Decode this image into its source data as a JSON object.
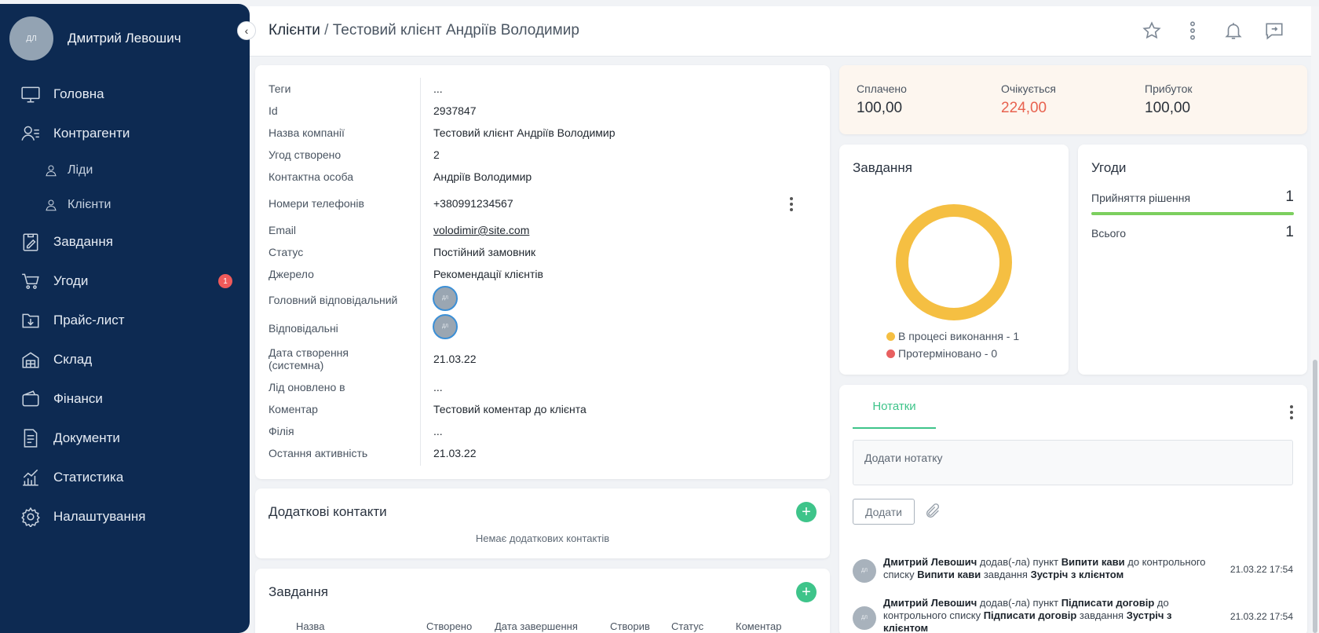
{
  "user": {
    "initials": "ДЛ",
    "name": "Дмитрий Левошич"
  },
  "nav": [
    {
      "label": "Головна",
      "icon": "monitor-icon"
    },
    {
      "label": "Контрагенти",
      "icon": "contacts-icon"
    },
    {
      "label": "Ліди",
      "icon": "user-icon",
      "sub": true
    },
    {
      "label": "Клієнти",
      "icon": "user-icon",
      "sub": true
    },
    {
      "label": "Завдання",
      "icon": "clipboard-icon"
    },
    {
      "label": "Угоди",
      "icon": "cart-icon",
      "badge": "1"
    },
    {
      "label": "Прайс-лист",
      "icon": "folder-icon"
    },
    {
      "label": "Склад",
      "icon": "warehouse-icon"
    },
    {
      "label": "Фінанси",
      "icon": "wallet-icon"
    },
    {
      "label": "Документи",
      "icon": "document-icon"
    },
    {
      "label": "Статистика",
      "icon": "chart-icon"
    },
    {
      "label": "Налаштування",
      "icon": "gear-icon"
    }
  ],
  "header": {
    "section": "Клієнти",
    "separator": "/",
    "current": "Тестовий клієнт Андріїв Володимир"
  },
  "info": {
    "tags_label": "Теги",
    "tags": "...",
    "id_label": "Id",
    "id": "2937847",
    "company_label": "Назва компанії",
    "company": "Тестовий клієнт Андріїв Володимир",
    "deals_label": "Угод створено",
    "deals": "2",
    "contact_label": "Контактна особа",
    "contact": "Андріїв Володимир",
    "phones_label": "Номери телефонів",
    "phone": "+380991234567",
    "email_label": "Email",
    "email": "volodimir@site.com",
    "status_label": "Статус",
    "status": "Постійний замовник",
    "source_label": "Джерело",
    "source": "Рекомендації клієнтів",
    "main_resp_label": "Головний відповідальний",
    "resp_label": "Відповідальні",
    "created_label_1": "Дата створення",
    "created_label_2": "(системна)",
    "created": "21.03.22",
    "lead_updated_label": "Лід оновлено в",
    "lead_updated": "...",
    "comment_label": "Коментар",
    "comment": "Тестовий коментар до клієнта",
    "branch_label": "Філія",
    "branch": "...",
    "activity_label": "Остання активність",
    "activity": "21.03.22",
    "avatar_initials": "ДЛ"
  },
  "contacts": {
    "title": "Додаткові контакти",
    "empty": "Немає додаткових контактів"
  },
  "tasks_table": {
    "title": "Завдання",
    "columns": [
      "Назва",
      "Створено",
      "Дата завершення",
      "Створив",
      "Статус",
      "Коментар"
    ]
  },
  "payments": {
    "paid_label": "Сплачено",
    "paid": "100,00",
    "expected_label": "Очікується",
    "expected": "224,00",
    "profit_label": "Прибуток",
    "profit": "100,00"
  },
  "tasks_chart": {
    "title": "Завдання",
    "legend": [
      {
        "label": "В процесі виконання - 1",
        "color": "#f5bf42"
      },
      {
        "label": "Протерміновано - 0",
        "color": "#e86060"
      }
    ]
  },
  "chart_data": {
    "type": "pie",
    "categories": [
      "В процесі виконання",
      "Протерміновано"
    ],
    "values": [
      1,
      0
    ],
    "colors": [
      "#f5bf42",
      "#e86060"
    ],
    "title": "Завдання",
    "donut": true
  },
  "deals": {
    "title": "Угоди",
    "decision_label": "Прийняття рішення",
    "decision": "1",
    "total_label": "Всього",
    "total": "1"
  },
  "notes": {
    "tab": "Нотатки",
    "placeholder": "Додати нотатку",
    "add_button": "Додати",
    "activity": [
      {
        "initials": "ДЛ",
        "author": "Дмитрий Левошич",
        "verb": "додав(-ла) пункт",
        "item": "Випити кави",
        "to": "до контрольного списку",
        "list": "Випити кави",
        "task_word": "завдання",
        "task": "Зустріч з клієнтом",
        "time": "21.03.22 17:54"
      },
      {
        "initials": "ДЛ",
        "author": "Дмитрий Левошич",
        "verb": "додав(-ла) пункт",
        "item": "Підписати договір",
        "to": "до контрольного списку",
        "list": "Підписати договір",
        "task_word": "завдання",
        "task": "Зустріч з клієнтом",
        "time": "21.03.22 17:54"
      }
    ]
  }
}
